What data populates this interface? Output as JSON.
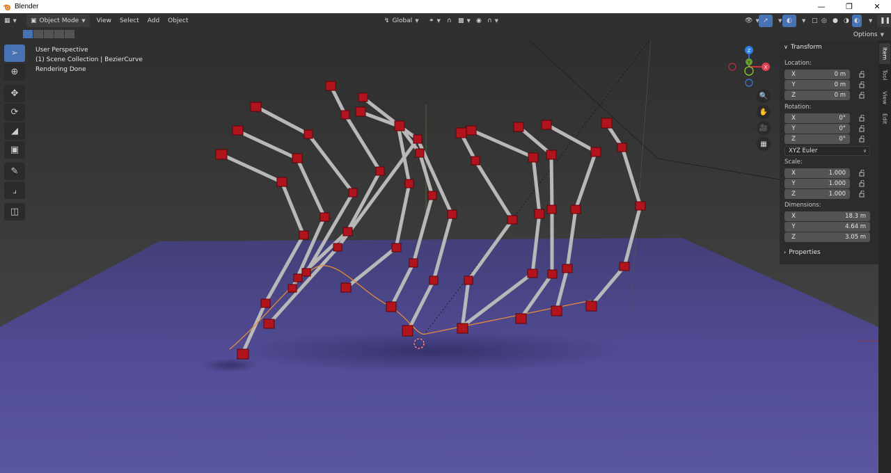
{
  "window": {
    "app_title": "Blender",
    "minimize_icon": "minimize-icon",
    "maximize_icon": "restore-icon",
    "close_icon": "close-icon"
  },
  "header": {
    "mode": "Object Mode",
    "menus": [
      "View",
      "Select",
      "Add",
      "Object"
    ],
    "transform_orientation": "Global",
    "options_label": "Options"
  },
  "viewport": {
    "perspective": "User Perspective",
    "collection": "(1) Scene Collection | BezierCurve",
    "status": "Rendering Done"
  },
  "gizmo": {
    "axes": [
      "Z",
      "Y",
      "X"
    ]
  },
  "sidebar_tabs": [
    "Item",
    "Tool",
    "View",
    "Edit"
  ],
  "transform": {
    "title": "Transform",
    "location_label": "Location:",
    "location": [
      {
        "axis": "X",
        "value": "0 m"
      },
      {
        "axis": "Y",
        "value": "0 m"
      },
      {
        "axis": "Z",
        "value": "0 m"
      }
    ],
    "rotation_label": "Rotation:",
    "rotation": [
      {
        "axis": "X",
        "value": "0°"
      },
      {
        "axis": "Y",
        "value": "0°"
      },
      {
        "axis": "Z",
        "value": "0°"
      }
    ],
    "rotation_mode": "XYZ Euler",
    "scale_label": "Scale:",
    "scale": [
      {
        "axis": "X",
        "value": "1.000"
      },
      {
        "axis": "Y",
        "value": "1.000"
      },
      {
        "axis": "Z",
        "value": "1.000"
      }
    ],
    "dimensions_label": "Dimensions:",
    "dimensions": [
      {
        "axis": "X",
        "value": "18.3 m"
      },
      {
        "axis": "Y",
        "value": "4.64 m"
      },
      {
        "axis": "Z",
        "value": "3.05 m"
      }
    ]
  },
  "properties": {
    "title": "Properties"
  },
  "colors": {
    "accent": "#4772b3",
    "ground": "#4f4b8c",
    "joint": "#b0141c",
    "rod": "#b8b8b8",
    "curve": "#e88a3a"
  }
}
